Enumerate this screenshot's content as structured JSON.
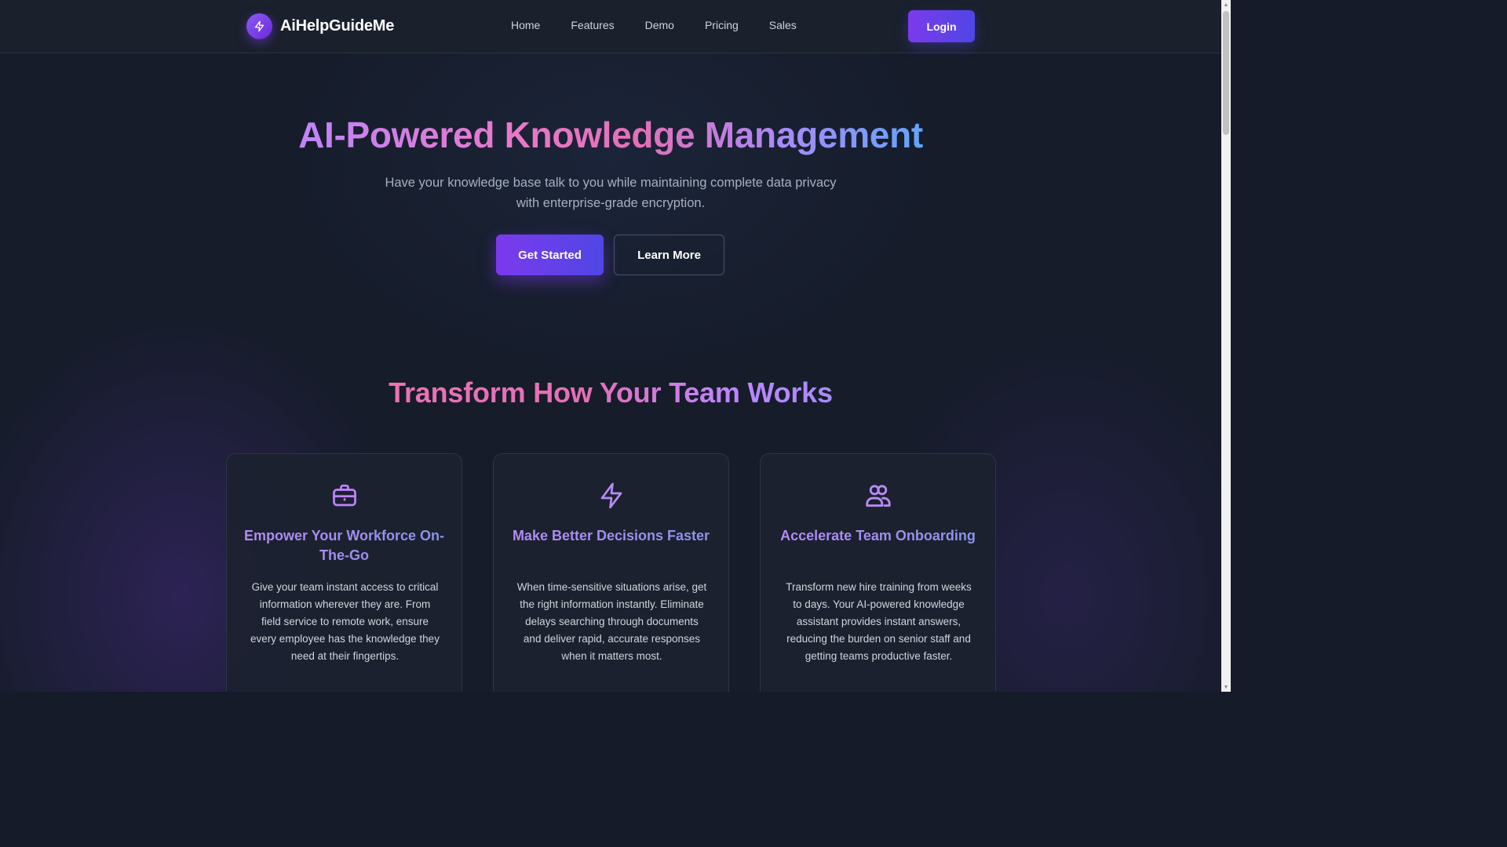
{
  "nav": {
    "brand": "AiHelpGuideMe",
    "links": [
      "Home",
      "Features",
      "Demo",
      "Pricing",
      "Sales"
    ],
    "login_label": "Login"
  },
  "hero": {
    "title": "AI-Powered Knowledge Management",
    "subtitle": "Have your knowledge base talk to you while maintaining complete data privacy with enterprise-grade encryption.",
    "primary_cta": "Get Started",
    "secondary_cta": "Learn More"
  },
  "features": {
    "title": "Transform How Your Team Works",
    "cards": [
      {
        "icon": "briefcase-icon",
        "title": "Empower Your Workforce On-The-Go",
        "text": "Give your team instant access to critical information wherever they are. From field service to remote work, ensure every employee has the knowledge they need at their fingertips."
      },
      {
        "icon": "lightning-icon",
        "title": "Make Better Decisions Faster",
        "text": "When time-sensitive situations arise, get the right information instantly. Eliminate delays searching through documents and deliver rapid, accurate responses when it matters most."
      },
      {
        "icon": "users-icon",
        "title": "Accelerate Team Onboarding",
        "text": "Transform new hire training from weeks to days. Your AI-powered knowledge assistant provides instant answers, reducing the burden on senior staff and getting teams productive faster."
      }
    ]
  },
  "colors": {
    "background": "#161c2a",
    "nav_background": "#1a202c",
    "accent_purple": "#7c3aed",
    "accent_indigo": "#4f46e5",
    "gradient_pink": "#e879c8",
    "gradient_blue": "#60a5fa",
    "icon_purple": "#c084fc"
  }
}
